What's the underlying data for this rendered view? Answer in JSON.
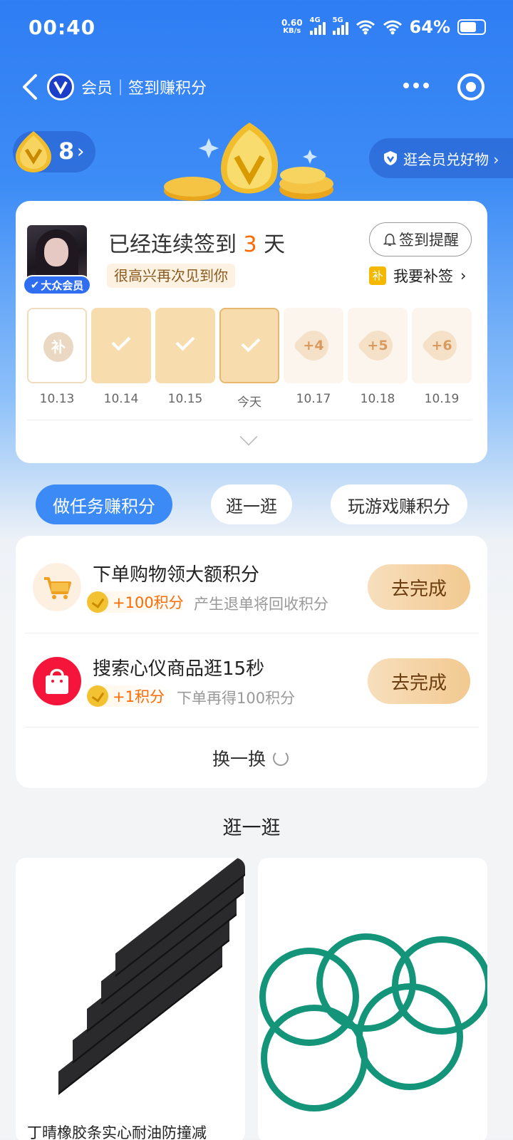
{
  "status_bar": {
    "time": "00:40",
    "net_speed": "0.60",
    "net_unit": "KB/s",
    "sig1": "4G",
    "sig2": "5G",
    "battery": "64%"
  },
  "header": {
    "title": "会员｜签到赚积分"
  },
  "points": {
    "value": "8",
    "arrow": "›"
  },
  "member_shop": {
    "label": "逛会员兑好物 ›"
  },
  "signin": {
    "streak_prefix": "已经连续签到 ",
    "streak_days": "3",
    "streak_suffix": " 天",
    "greeting": "很高兴再次见到你",
    "member_level": "大众会员",
    "remind_label": "签到提醒",
    "makeup_icon": "补",
    "makeup_label": "我要补签",
    "makeup_arrow": "›",
    "days": [
      {
        "label": "10.13",
        "state": "makeup",
        "mark": "补"
      },
      {
        "label": "10.14",
        "state": "done",
        "mark": ""
      },
      {
        "label": "10.15",
        "state": "done",
        "mark": ""
      },
      {
        "label": "今天",
        "state": "today",
        "mark": ""
      },
      {
        "label": "10.17",
        "state": "future",
        "mark": "+4"
      },
      {
        "label": "10.18",
        "state": "future",
        "mark": "+5"
      },
      {
        "label": "10.19",
        "state": "future",
        "mark": "+6"
      }
    ]
  },
  "tabs": [
    {
      "label": "做任务赚积分",
      "active": true
    },
    {
      "label": "逛一逛",
      "active": false
    },
    {
      "label": "玩游戏赚积分",
      "active": false
    }
  ],
  "tasks": [
    {
      "title": "下单购物领大额积分",
      "reward": "+100积分",
      "note": "产生退单将回收积分",
      "button": "去完成",
      "icon": "cart-icon"
    },
    {
      "title": "搜索心仪商品逛15秒",
      "reward": "+1积分",
      "note": "下单再得100积分",
      "button": "去完成",
      "icon": "shopping-bag-icon"
    }
  ],
  "refresh_label": "换一换",
  "browse": {
    "title": "逛一逛",
    "products": [
      {
        "name": "丁晴橡胶条实心耐油防撞减"
      },
      {
        "name": ""
      }
    ]
  },
  "colors": {
    "primary_blue": "#3b8af5",
    "accent_orange": "#ff6a00",
    "gold": "#f2c990"
  }
}
